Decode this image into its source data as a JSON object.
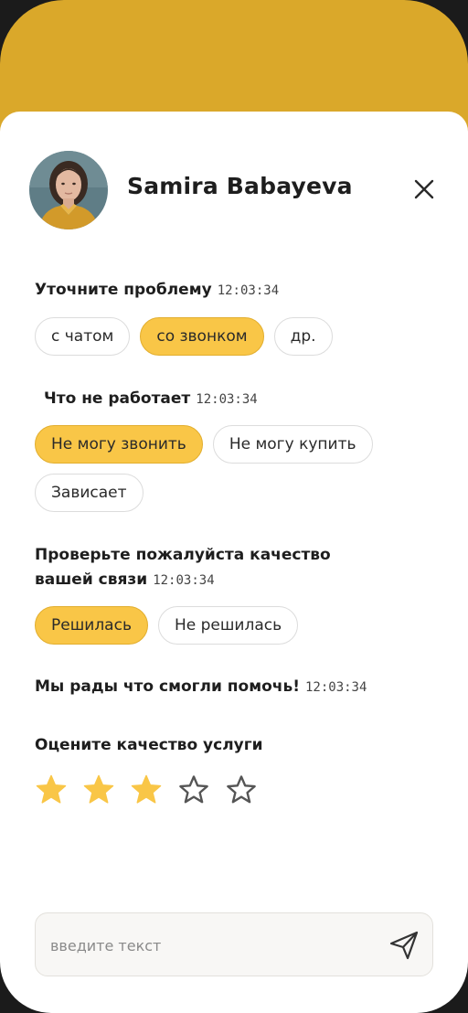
{
  "header": {
    "user_name": "Samira Babayeva",
    "close_icon": "close-icon",
    "avatar_icon": "avatar"
  },
  "questions": {
    "q1": {
      "text": "Уточните проблему",
      "time": "12:03:34"
    },
    "q2": {
      "text": "Что не работает",
      "time": "12:03:34"
    },
    "q3": {
      "line1": "Проверьте пожалуйста качество",
      "line2": "вашей связи",
      "time": "12:03:34"
    },
    "q4": {
      "text": "Мы рады что смогли помочь!",
      "time": "12:03:34"
    },
    "q5": {
      "text": "Оцените качество услуги"
    }
  },
  "options": {
    "topic": [
      "с чатом",
      "со звонком",
      "др."
    ],
    "topic_selected": "со звонком",
    "issue": [
      "Не могу звонить",
      "Не могу купить",
      "Зависает"
    ],
    "issue_selected": "Не могу звонить",
    "resolved": [
      "Решилась",
      "Не решилась"
    ],
    "resolved_selected": "Решилась"
  },
  "rating": {
    "value": 3,
    "max": 5
  },
  "composer": {
    "placeholder": "введите текст",
    "value": "",
    "send_icon": "send-icon"
  },
  "colors": {
    "header_bg": "#DAA82A",
    "chip_selected": "#F9C647",
    "star_filled": "#F9C647",
    "star_empty_stroke": "#555555"
  }
}
